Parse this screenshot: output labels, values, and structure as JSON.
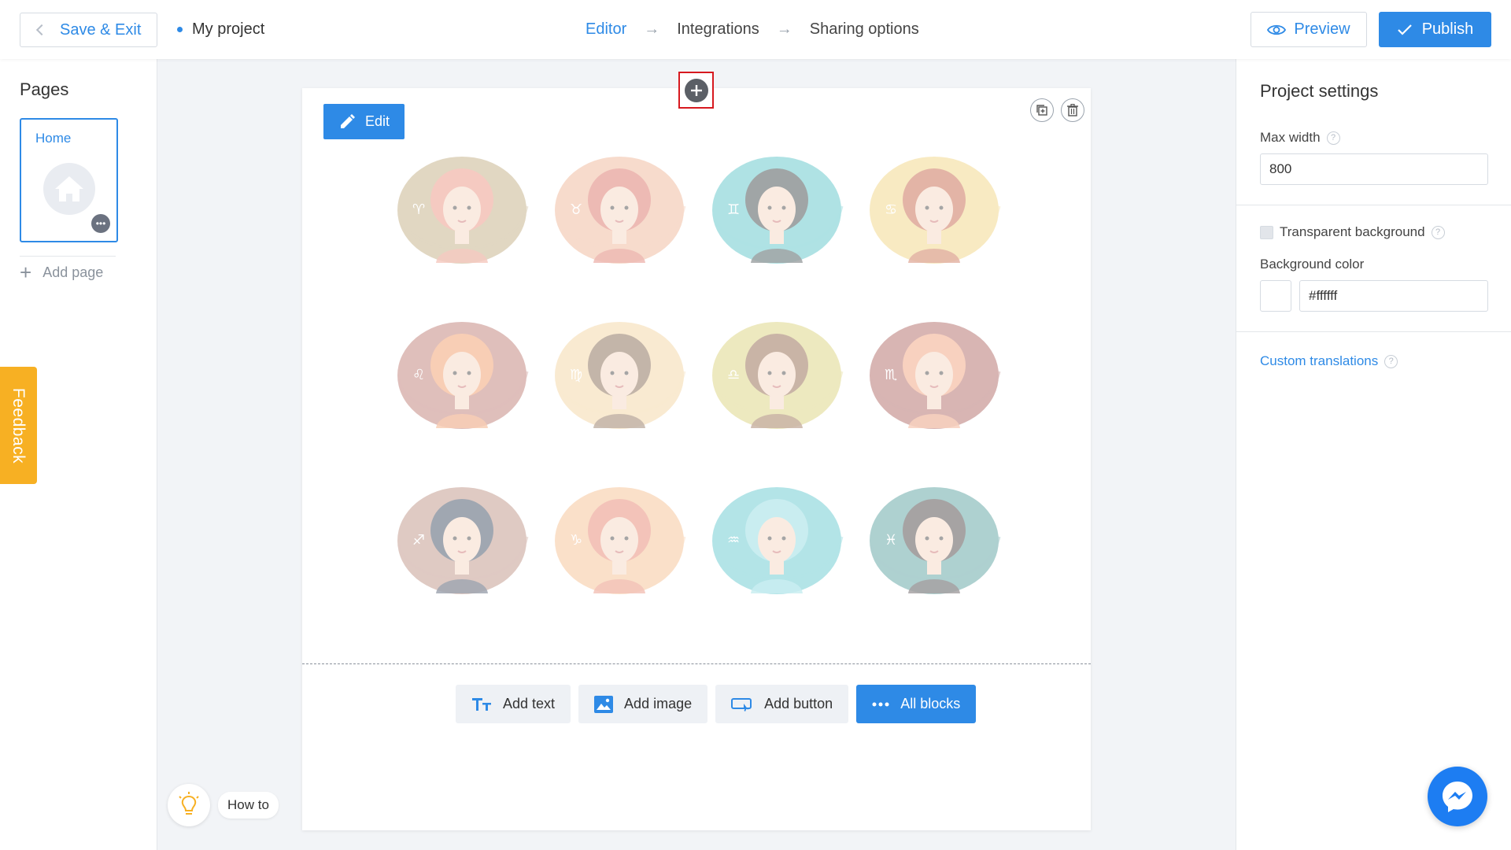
{
  "topbar": {
    "save_exit_label": "Save & Exit",
    "project_name": "My project",
    "steps": [
      "Editor",
      "Integrations",
      "Sharing options"
    ],
    "active_step": "Editor",
    "preview_label": "Preview",
    "publish_label": "Publish"
  },
  "left_sidebar": {
    "title": "Pages",
    "pages": [
      {
        "label": "Home",
        "icon": "home-icon"
      }
    ],
    "more_glyph": "•••",
    "add_page_label": "Add page"
  },
  "feedback_label": "Feedback",
  "howto_label": "How to",
  "canvas": {
    "edit_label": "Edit",
    "zodiac_avatars": [
      {
        "sign": "Aries",
        "glyph": "♈",
        "bg": "#bda77a",
        "hair": "#e98c78"
      },
      {
        "sign": "Taurus",
        "glyph": "♉",
        "bg": "#eeb08f",
        "hair": "#d9675b"
      },
      {
        "sign": "Gemini",
        "glyph": "♊",
        "bg": "#4fc1c4",
        "hair": "#2f3a3c"
      },
      {
        "sign": "Cancer",
        "glyph": "♋",
        "bg": "#f0d27a",
        "hair": "#c35a3b"
      },
      {
        "sign": "Leo",
        "glyph": "♌",
        "bg": "#b9726b",
        "hair": "#f0935c"
      },
      {
        "sign": "Virgo",
        "glyph": "♍",
        "bg": "#f2d19a",
        "hair": "#7b5c42"
      },
      {
        "sign": "Libra",
        "glyph": "♎",
        "bg": "#d9cf73",
        "hair": "#8a5a3c"
      },
      {
        "sign": "Scorpio",
        "glyph": "♏",
        "bg": "#a95c59",
        "hair": "#f09a72"
      },
      {
        "sign": "Sagittarius",
        "glyph": "♐",
        "bg": "#b98b7c",
        "hair": "#2f3d55"
      },
      {
        "sign": "Capricorn",
        "glyph": "♑",
        "bg": "#f6bc8a",
        "hair": "#e57c65"
      },
      {
        "sign": "Aquarius",
        "glyph": "♒",
        "bg": "#58c5cc",
        "hair": "#8ad9e0"
      },
      {
        "sign": "Pisces",
        "glyph": "♓",
        "bg": "#4e9a98",
        "hair": "#3b3436"
      }
    ],
    "add_buttons": [
      {
        "label": "Add text",
        "icon": "text-format-icon"
      },
      {
        "label": "Add image",
        "icon": "image-icon"
      },
      {
        "label": "Add button",
        "icon": "button-icon"
      },
      {
        "label": "All blocks",
        "icon": "more-dots-icon"
      }
    ]
  },
  "right_sidebar": {
    "title": "Project settings",
    "max_width_label": "Max width",
    "max_width_value": "800",
    "transparent_bg_label": "Transparent background",
    "transparent_bg_checked": false,
    "bg_color_label": "Background color",
    "bg_color_value": "#ffffff",
    "custom_translations_label": "Custom translations"
  },
  "colors": {
    "accent": "#2e8ae6",
    "feedback": "#f7b023",
    "highlight_box": "#d7191f",
    "messenger": "#1d7df2"
  }
}
